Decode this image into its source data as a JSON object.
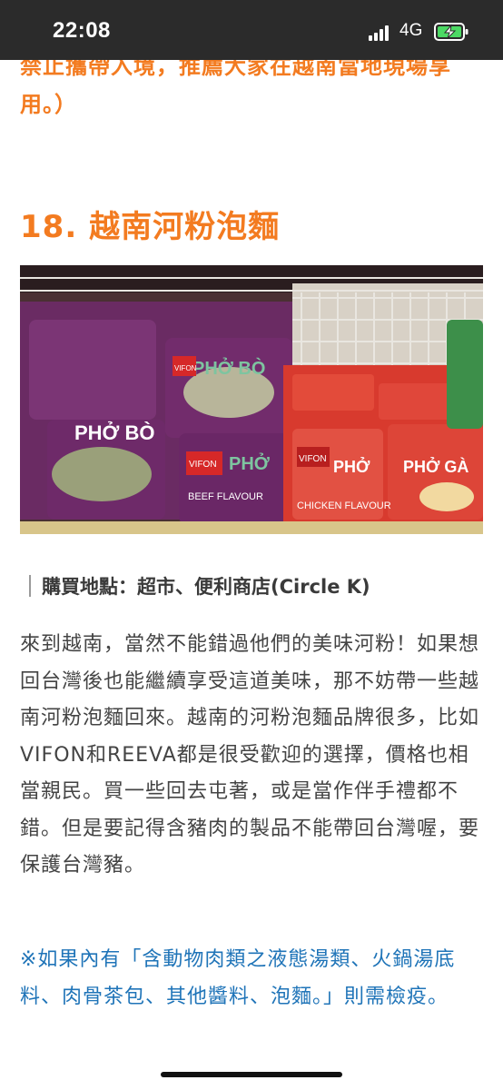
{
  "status_bar": {
    "time": "22:08",
    "network": "4G",
    "signal_icon": "signal-bars-icon",
    "battery_icon": "battery-charging-icon"
  },
  "article": {
    "top_note": "禁止攜帶入境，推薦大家在越南當地現場享用。）",
    "section_title": "18. 越南河粉泡麵",
    "image": {
      "description_icon": "instant-noodle-shelf-photo",
      "package_texts": [
        "PHỞ BÒ",
        "VIFON",
        "PHỞ GÀ",
        "CHICKEN FLAVOUR",
        "BEEF FLAVOUR"
      ]
    },
    "location": "購買地點：超市、便利商店(Circle K)",
    "body": "來到越南，當然不能錯過他們的美味河粉！如果想回台灣後也能繼續享受這道美味，那不妨帶一些越南河粉泡麵回來。越南的河粉泡麵品牌很多，比如VIFON和REEVA都是很受歡迎的選擇，價格也相當親民。買一些回去屯著，或是當作伴手禮都不錯。但是要記得含豬肉的製品不能帶回台灣喔，要保護台灣豬。",
    "quarantine_note": "※如果內有「含動物肉類之液態湯類、火鍋湯底料、肉骨茶包、其他醬料、泡麵。」則需檢疫。"
  },
  "colors": {
    "accent_orange": "#f37b20",
    "note_blue": "#1f74b8",
    "body_text": "#444444",
    "status_bar_bg": "#2b2b2b"
  }
}
